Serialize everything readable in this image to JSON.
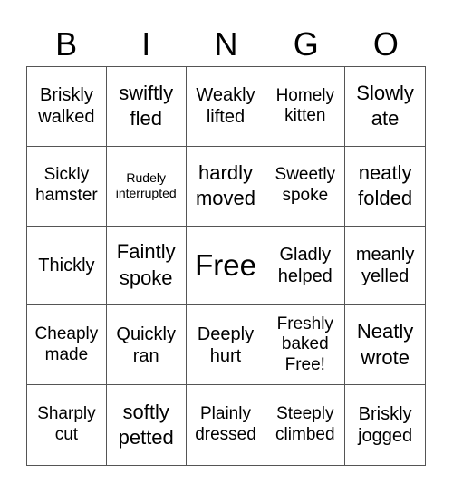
{
  "header": {
    "letters": [
      "B",
      "I",
      "N",
      "G",
      "O"
    ]
  },
  "cells": [
    {
      "text": "Briskly walked",
      "size": "s3"
    },
    {
      "text": "swiftly fled",
      "size": "s4"
    },
    {
      "text": "Weakly lifted",
      "size": "s3"
    },
    {
      "text": "Homely kitten",
      "size": "s2"
    },
    {
      "text": "Slowly ate",
      "size": "s4"
    },
    {
      "text": "Sickly hamster",
      "size": "s2"
    },
    {
      "text": "Rudely interrupted",
      "size": "s1"
    },
    {
      "text": "hardly moved",
      "size": "s4"
    },
    {
      "text": "Sweetly spoke",
      "size": "s2"
    },
    {
      "text": "neatly folded",
      "size": "s4"
    },
    {
      "text": "Thickly",
      "size": "s3"
    },
    {
      "text": "Faintly spoke",
      "size": "s4"
    },
    {
      "text": "Free",
      "size": "sfree"
    },
    {
      "text": "Gladly helped",
      "size": "s3"
    },
    {
      "text": "meanly yelled",
      "size": "s3"
    },
    {
      "text": "Cheaply made",
      "size": "s2"
    },
    {
      "text": "Quickly ran",
      "size": "s3"
    },
    {
      "text": "Deeply hurt",
      "size": "s3"
    },
    {
      "text": "Freshly baked Free!",
      "size": "s2"
    },
    {
      "text": "Neatly wrote",
      "size": "s4"
    },
    {
      "text": "Sharply cut",
      "size": "s2"
    },
    {
      "text": "softly petted",
      "size": "s4"
    },
    {
      "text": "Plainly dressed",
      "size": "s2"
    },
    {
      "text": "Steeply climbed",
      "size": "s2"
    },
    {
      "text": "Briskly jogged",
      "size": "s3"
    }
  ]
}
